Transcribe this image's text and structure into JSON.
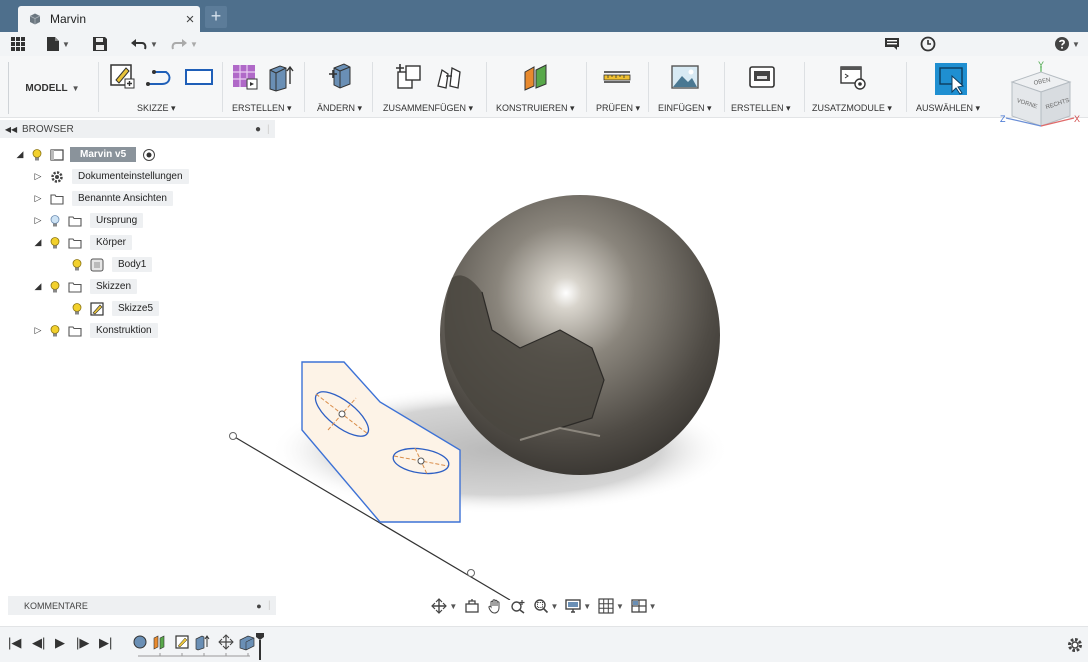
{
  "window": {
    "document_title": "Marvin",
    "new_tab_symbol": "+"
  },
  "ribbon": {
    "mode_label": "MODELL",
    "groups": [
      "SKIZZE",
      "ERSTELLEN",
      "ÄNDERN",
      "ZUSAMMENFÜGEN",
      "KONSTRUIEREN",
      "PRÜFEN",
      "EINFÜGEN",
      "ERSTELLEN",
      "ZUSATZMODULE",
      "AUSWÄHLEN"
    ],
    "accent_color": "#1f8fd1"
  },
  "browser": {
    "title": "BROWSER",
    "root": "Marvin v5",
    "items": [
      "Dokumenteinstellungen",
      "Benannte Ansichten",
      "Ursprung",
      "Körper",
      "Body1",
      "Skizzen",
      "Skizze5",
      "Konstruktion"
    ]
  },
  "viewcube": {
    "top": "OBEN",
    "front": "VORNE",
    "right": "RECHTS",
    "axis_x": "X",
    "axis_y": "Y",
    "axis_z": "Z"
  },
  "comments": {
    "title": "KOMMENTARE"
  },
  "icons": {
    "app": "grid-icon",
    "file": "file-icon",
    "save": "save-icon",
    "undo": "undo-icon",
    "redo": "redo-icon",
    "job_status": "job-status-icon",
    "history": "clock-icon",
    "help": "help-icon",
    "settings": "gear-icon"
  },
  "colors": {
    "titlebar": "#4e6f8c",
    "sketch_fill": "#fdf3e7",
    "sketch_stroke": "#3d72d6",
    "sphere": "#6a655d"
  }
}
